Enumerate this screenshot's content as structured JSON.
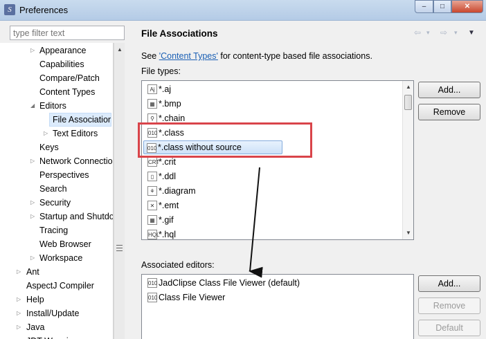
{
  "window": {
    "title": "Preferences",
    "min": "–",
    "max": "□",
    "close": "✕",
    "app_icon": "S"
  },
  "filter": {
    "placeholder": "type filter text"
  },
  "tree": {
    "items": [
      {
        "label": "Appearance",
        "toggle": "▷"
      },
      {
        "label": "Capabilities",
        "toggle": ""
      },
      {
        "label": "Compare/Patch",
        "toggle": ""
      },
      {
        "label": "Content Types",
        "toggle": ""
      },
      {
        "label": "Editors",
        "toggle": "◢"
      },
      {
        "label": "File Associations",
        "toggle": ""
      },
      {
        "label": "Text Editors",
        "toggle": "▷"
      },
      {
        "label": "Keys",
        "toggle": ""
      },
      {
        "label": "Network Connections",
        "toggle": "▷"
      },
      {
        "label": "Perspectives",
        "toggle": ""
      },
      {
        "label": "Search",
        "toggle": ""
      },
      {
        "label": "Security",
        "toggle": "▷"
      },
      {
        "label": "Startup and Shutdown",
        "toggle": "▷"
      },
      {
        "label": "Tracing",
        "toggle": ""
      },
      {
        "label": "Web Browser",
        "toggle": ""
      },
      {
        "label": "Workspace",
        "toggle": "▷"
      },
      {
        "label": "Ant",
        "toggle": "▷"
      },
      {
        "label": "AspectJ Compiler",
        "toggle": ""
      },
      {
        "label": "Help",
        "toggle": "▷"
      },
      {
        "label": "Install/Update",
        "toggle": "▷"
      },
      {
        "label": "Java",
        "toggle": "▷"
      },
      {
        "label": "JDT Weaving",
        "toggle": ""
      }
    ]
  },
  "page": {
    "title": "File Associations",
    "see_prefix": "See ",
    "link_text": "'Content Types'",
    "see_suffix": " for content-type based file associations.",
    "file_types_label": "File types:",
    "assoc_label": "Associated editors:",
    "nav": {
      "back": "⇦",
      "back_menu": "▾",
      "forward": "⇨",
      "forward_menu": "▾",
      "view_menu": "▼"
    }
  },
  "file_types": [
    {
      "name": "*.aj",
      "icon": "aj-file-icon",
      "glyph": "Aj"
    },
    {
      "name": "*.bmp",
      "icon": "image-file-icon",
      "glyph": "▦"
    },
    {
      "name": "*.chain",
      "icon": "chain-file-icon",
      "glyph": "⚲"
    },
    {
      "name": "*.class",
      "icon": "class-file-icon",
      "glyph": "010"
    },
    {
      "name": "*.class without source",
      "icon": "class-file-icon",
      "glyph": "010"
    },
    {
      "name": "*.crit",
      "icon": "crit-file-icon",
      "glyph": "CRT"
    },
    {
      "name": "*.ddl",
      "icon": "ddl-file-icon",
      "glyph": "▯"
    },
    {
      "name": "*.diagram",
      "icon": "diagram-file-icon",
      "glyph": "⚘"
    },
    {
      "name": "*.emt",
      "icon": "emt-file-icon",
      "glyph": "✕"
    },
    {
      "name": "*.gif",
      "icon": "image-file-icon",
      "glyph": "▦"
    },
    {
      "name": "*.hql",
      "icon": "hql-file-icon",
      "glyph": "HQL"
    }
  ],
  "editors": [
    {
      "name": "JadClipse Class File Viewer (default)",
      "icon": "class-viewer-icon",
      "glyph": "010"
    },
    {
      "name": "Class File Viewer",
      "icon": "class-viewer-icon",
      "glyph": "010"
    }
  ],
  "buttons": {
    "file_add": "Add...",
    "file_remove": "Remove",
    "editor_add": "Add...",
    "editor_remove": "Remove",
    "editor_default": "Default"
  },
  "colors": {
    "highlight": "#d9444a",
    "link": "#1a5fb4",
    "selection": "#cde1f8"
  }
}
